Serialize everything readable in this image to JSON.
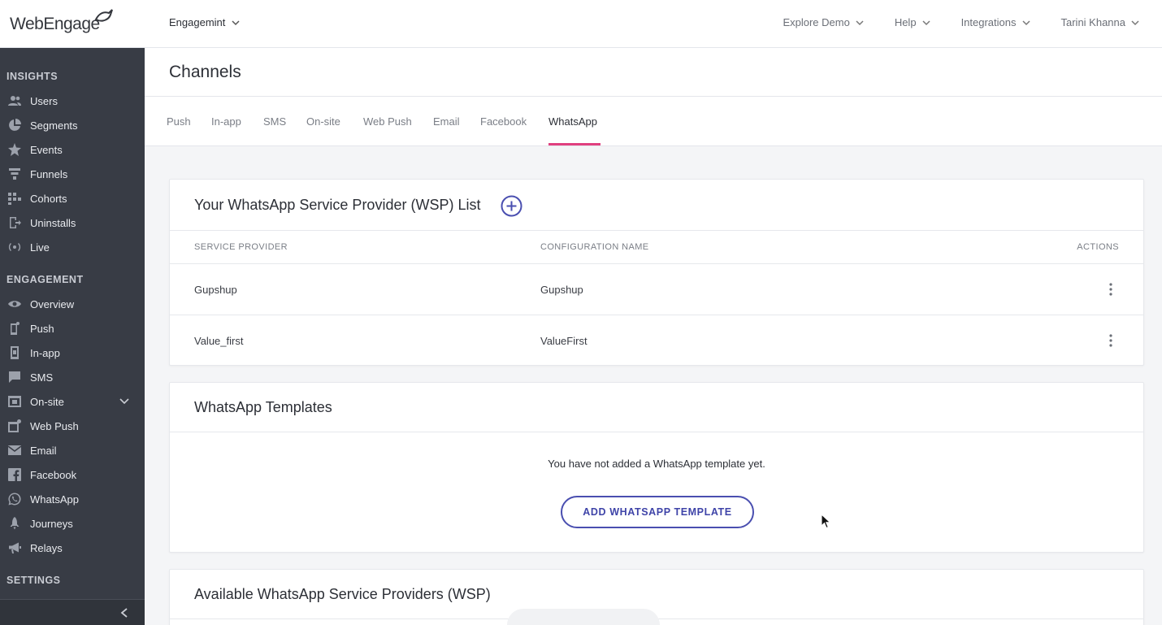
{
  "brand": {
    "name_part1": "Web",
    "name_part2": "Engage"
  },
  "topbar": {
    "project": "Engagemint",
    "nav": [
      "Explore Demo",
      "Help",
      "Integrations",
      "Tarini Khanna"
    ]
  },
  "sidebar": {
    "insights_title": "INSIGHTS",
    "insights": [
      {
        "label": "Users",
        "icon": "users-icon"
      },
      {
        "label": "Segments",
        "icon": "pie-chart-icon"
      },
      {
        "label": "Events",
        "icon": "star-icon"
      },
      {
        "label": "Funnels",
        "icon": "funnel-icon"
      },
      {
        "label": "Cohorts",
        "icon": "grid-icon"
      },
      {
        "label": "Uninstalls",
        "icon": "exit-icon"
      },
      {
        "label": "Live",
        "icon": "broadcast-icon"
      }
    ],
    "engagement_title": "ENGAGEMENT",
    "engagement": [
      {
        "label": "Overview",
        "icon": "eye-icon"
      },
      {
        "label": "Push",
        "icon": "mobile-icon"
      },
      {
        "label": "In-app",
        "icon": "tablet-icon"
      },
      {
        "label": "SMS",
        "icon": "message-icon"
      },
      {
        "label": "On-site",
        "icon": "window-icon"
      },
      {
        "label": "Web Push",
        "icon": "browser-icon"
      },
      {
        "label": "Email",
        "icon": "mail-icon"
      },
      {
        "label": "Facebook",
        "icon": "facebook-icon"
      },
      {
        "label": "WhatsApp",
        "icon": "whatsapp-icon"
      },
      {
        "label": "Journeys",
        "icon": "rocket-icon"
      },
      {
        "label": "Relays",
        "icon": "megaphone-icon"
      }
    ],
    "settings_title": "SETTINGS"
  },
  "page": {
    "title": "Channels",
    "tabs": [
      "Push",
      "In-app",
      "SMS",
      "On-site",
      "Web Push",
      "Email",
      "Facebook",
      "WhatsApp"
    ],
    "active_tab": "WhatsApp"
  },
  "wsp_list": {
    "title": "Your WhatsApp Service Provider (WSP) List",
    "headers": [
      "SERVICE PROVIDER",
      "CONFIGURATION NAME",
      "ACTIONS"
    ],
    "rows": [
      {
        "provider": "Gupshup",
        "config": "Gupshup"
      },
      {
        "provider": "Value_first",
        "config": "ValueFirst"
      }
    ]
  },
  "templates": {
    "title": "WhatsApp Templates",
    "empty_message": "You have not added a WhatsApp template yet.",
    "add_button": "ADD WHATSAPP TEMPLATE"
  },
  "available": {
    "title": "Available WhatsApp Service Providers (WSP)"
  },
  "colors": {
    "sidebar_bg": "#383c45",
    "accent_pink": "#e0407f",
    "primary_indigo": "#4a4fb0"
  }
}
